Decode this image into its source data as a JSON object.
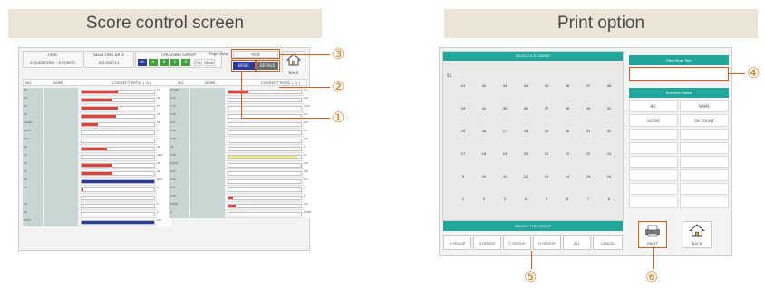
{
  "left": {
    "title": "Score control screen",
    "header": {
      "units_label": "Units",
      "units_value": "8 QUESTIONS - 8 POINTS",
      "date_label": "SELECTING DATE",
      "date_value": "2013/07/11",
      "group_label": "CHOOSING GROUP",
      "groups": [
        "All",
        "A",
        "B",
        "C",
        "D"
      ],
      "prev": "Pre",
      "next": "Next",
      "page_label": "Page View",
      "print": "Print",
      "basic": "BASIC",
      "details": "DETAILS",
      "back": "BACK"
    },
    "columns": [
      "NO.",
      "NAME",
      "CORRECT RATIO ( % )",
      "NO.",
      "NAME",
      "CORRECT RATIO ( % )"
    ],
    "left_rows": [
      {
        "no": "44",
        "val": "57",
        "fill": 0.5,
        "color": "red"
      },
      {
        "no": "54",
        "val": "46",
        "fill": 0.42,
        "color": "red"
      },
      {
        "no": "56",
        "val": "57",
        "fill": 0.5,
        "color": "red"
      },
      {
        "no": "40",
        "val": "55",
        "fill": 0.48,
        "color": "red"
      },
      {
        "no": "10464",
        "val": "29",
        "fill": 0.22,
        "color": "red"
      },
      {
        "no": "6024",
        "val": "0",
        "fill": 0,
        "color": "red"
      },
      {
        "no": "717",
        "val": "0",
        "fill": 0,
        "color": "red"
      },
      {
        "no": "35",
        "val": "40",
        "fill": 0.35,
        "color": "red"
      },
      {
        "no": "57",
        "val": "4456",
        "fill": 0,
        "color": "red"
      },
      {
        "no": "43",
        "val": "46",
        "fill": 0.42,
        "color": "red"
      },
      {
        "no": "31",
        "val": "46",
        "fill": 0.42,
        "color": "red"
      },
      {
        "no": "33",
        "val": "9047",
        "fill": 1,
        "color": "blue"
      },
      {
        "no": "72",
        "val": "3",
        "fill": 0.03,
        "color": "red"
      },
      {
        "no": "",
        "val": "",
        "fill": 0,
        "color": "red"
      },
      {
        "no": "13",
        "val": "0",
        "fill": 0,
        "color": "red"
      },
      {
        "no": "36",
        "val": "0",
        "fill": 0,
        "color": "red"
      },
      {
        "no": "6090",
        "val": "120",
        "fill": 1,
        "color": "blue"
      }
    ],
    "right_rows": [
      {
        "no": "37464",
        "val": "32",
        "fill": 0.27,
        "color": "red"
      },
      {
        "no": "972",
        "val": "254",
        "fill": 0,
        "color": "red"
      },
      {
        "no": "774",
        "val": "4240",
        "fill": 0,
        "color": "red"
      },
      {
        "no": "245",
        "val": "247",
        "fill": 0,
        "color": "red"
      },
      {
        "no": "247",
        "val": "245",
        "fill": 0,
        "color": "red"
      },
      {
        "no": "246",
        "val": "247",
        "fill": 0,
        "color": "red"
      },
      {
        "no": "248",
        "val": "246",
        "fill": 0,
        "color": "red"
      },
      {
        "no": "31",
        "val": "0",
        "fill": 0,
        "color": "red"
      },
      {
        "no": "238",
        "val": "97",
        "fill": 0.95,
        "color": "yellow"
      },
      {
        "no": "6240",
        "val": "238",
        "fill": 0,
        "color": "red"
      },
      {
        "no": "247",
        "val": "238",
        "fill": 0,
        "color": "red"
      },
      {
        "no": "246",
        "val": "247",
        "fill": 0,
        "color": "red"
      },
      {
        "no": "247",
        "val": "0",
        "fill": 0,
        "color": "red"
      },
      {
        "no": "246",
        "val": "8",
        "fill": 0.06,
        "color": "red"
      },
      {
        "no": "3698",
        "val": "113",
        "fill": 0.1,
        "color": "red"
      },
      {
        "no": "2",
        "val": "14694",
        "fill": 0,
        "color": "red"
      }
    ]
  },
  "right": {
    "title": "Print option",
    "select_student": "SELECT A STUDENT",
    "start_label": "56",
    "numbers": [
      [
        "41",
        "42",
        "43",
        "44",
        "45",
        "46",
        "47",
        "48"
      ],
      [
        "33",
        "34",
        "35",
        "36",
        "37",
        "38",
        "39",
        "32"
      ],
      [
        "25",
        "26",
        "27",
        "28",
        "29",
        "30",
        "31",
        "32"
      ],
      [
        "17",
        "18",
        "19",
        "20",
        "21",
        "22",
        "23",
        "24"
      ],
      [
        "9",
        "10",
        "11",
        "12",
        "13",
        "14",
        "15",
        "16"
      ],
      [
        "1",
        "2",
        "3",
        "4",
        "5",
        "6",
        "7",
        "8"
      ]
    ],
    "select_group": "SELECT THE GROUP",
    "group_buttons": [
      "A GROUP",
      "B GROUP",
      "C GROUP",
      "D GROUP",
      "ALL",
      "CANCEL"
    ],
    "print_head_title": "Print Head Title",
    "sort_title": "Sort Item Select",
    "sort_cols": [
      "NO.",
      "NAME"
    ],
    "sort_row2": [
      "SCORE",
      "OK COUNT"
    ],
    "print_button": "PRINT",
    "back_button": "BACK"
  },
  "callouts": [
    "③",
    "②",
    "①",
    "④",
    "⑤",
    "⑥"
  ],
  "colors": {
    "accent": "#e05a1a",
    "teal": "#20a69a",
    "bar_red": "#e0413a",
    "bar_blue": "#2a3a9a",
    "bar_yellow": "#f4ee8a"
  }
}
